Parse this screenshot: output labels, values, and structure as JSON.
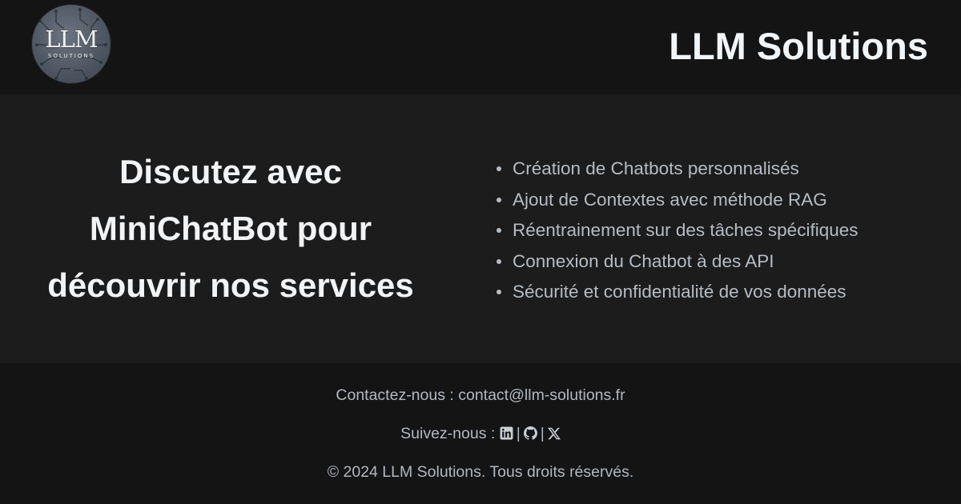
{
  "header": {
    "logo": {
      "main_text": "LLM",
      "sub_text": "SOLUTIONS"
    },
    "brand": "LLM Solutions"
  },
  "main": {
    "headline": "Discutez avec MiniChatBot pour découvrir nos services",
    "services": [
      "Création de Chatbots personnalisés",
      "Ajout de Contextes avec méthode RAG",
      "Réentrainement sur des tâches spécifiques",
      "Connexion du Chatbot à des API",
      "Sécurité et confidentialité de vos données"
    ]
  },
  "footer": {
    "contact_label": "Contactez-nous : ",
    "contact_email": "contact@llm-solutions.fr",
    "follow_label": "Suivez-nous : ",
    "social": [
      "linkedin-icon",
      "github-icon",
      "x-icon"
    ],
    "separator": "|",
    "copyright": "© 2024 LLM Solutions. Tous droits réservés."
  },
  "colors": {
    "header_bg": "#141414",
    "main_bg": "#1c1c1c",
    "footer_bg": "#141414",
    "headline": "#f1f3f5",
    "list_text": "#b6bcc3"
  }
}
